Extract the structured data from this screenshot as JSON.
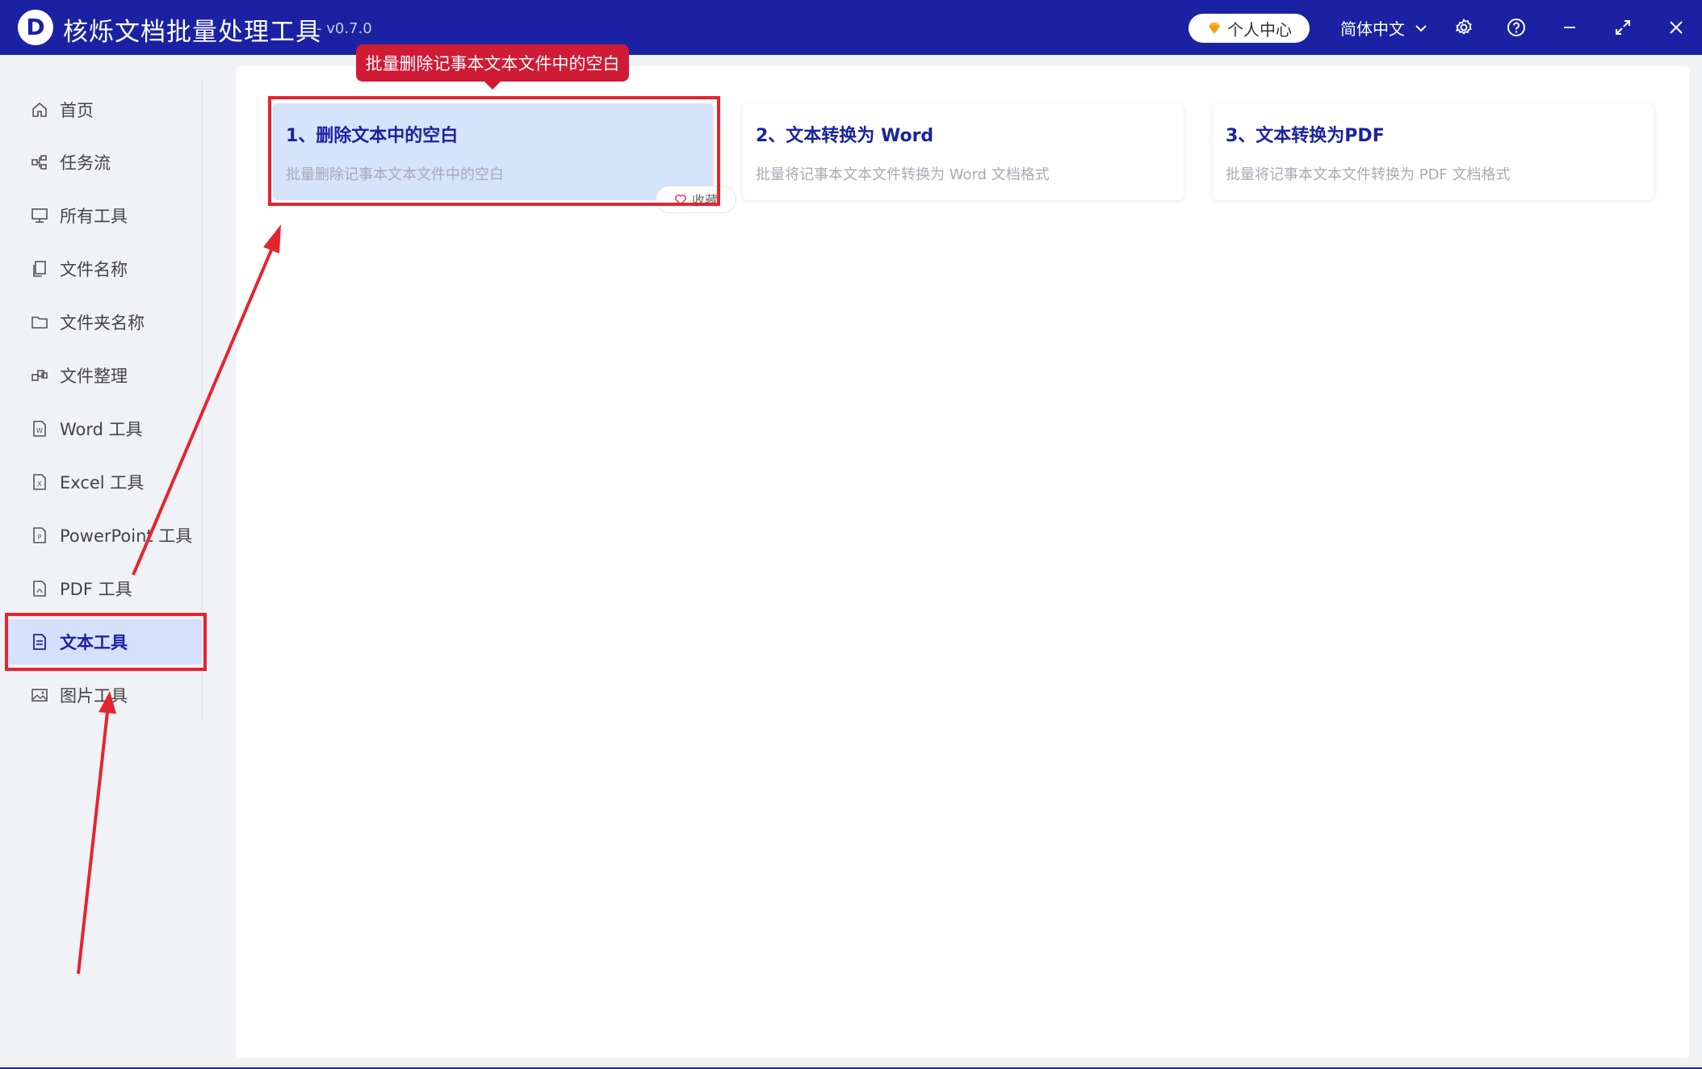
{
  "app": {
    "logo_letter": "D",
    "title": "核烁文档批量处理工具",
    "version": "- v0.7.0"
  },
  "header": {
    "user_center": "个人中心",
    "language": "简体中文"
  },
  "sidebar": {
    "items": [
      {
        "label": "首页",
        "icon": "home-icon"
      },
      {
        "label": "任务流",
        "icon": "workflow-icon"
      },
      {
        "label": "所有工具",
        "icon": "monitor-icon"
      },
      {
        "label": "文件名称",
        "icon": "file-copy-icon"
      },
      {
        "label": "文件夹名称",
        "icon": "folder-icon"
      },
      {
        "label": "文件整理",
        "icon": "organize-icon"
      },
      {
        "label": "Word 工具",
        "icon": "word-file-icon"
      },
      {
        "label": "Excel 工具",
        "icon": "excel-file-icon"
      },
      {
        "label": "PowerPoint 工具",
        "icon": "ppt-file-icon"
      },
      {
        "label": "PDF 工具",
        "icon": "pdf-file-icon"
      },
      {
        "label": "文本工具",
        "icon": "text-file-icon",
        "active": true
      },
      {
        "label": "图片工具",
        "icon": "image-icon"
      }
    ]
  },
  "tooltip": "批量删除记事本文本文件中的空白",
  "cards": [
    {
      "title": "1、删除文本中的空白",
      "desc": "批量删除记事本文本文件中的空白",
      "selected": true
    },
    {
      "title": "2、文本转换为 Word",
      "desc": "批量将记事本文本文件转换为 Word 文档格式"
    },
    {
      "title": "3、文本转换为PDF",
      "desc": "批量将记事本文本文件转换为 PDF 文档格式"
    }
  ],
  "favorite_label": "收藏",
  "colors": {
    "brand": "#1a22a3",
    "active_bg": "#d5e0fb",
    "annotation": "#e4252f",
    "tooltip": "#d01b35"
  }
}
